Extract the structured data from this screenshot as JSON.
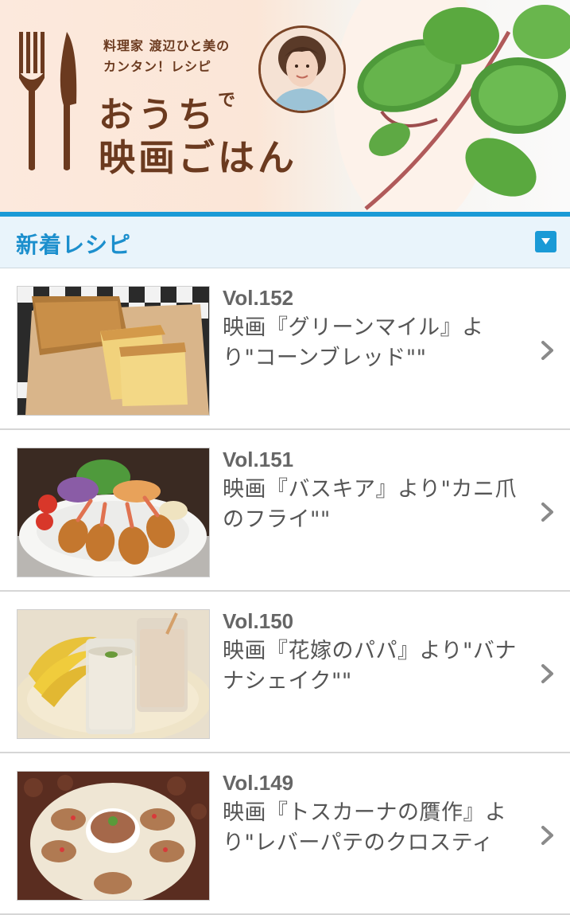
{
  "banner": {
    "subtitle_line1": "料理家 渡辺ひと美の",
    "subtitle_line2": "カンタン！レシピ",
    "title_line1_main": "おうち",
    "title_line1_small": "で",
    "title_line2": "映画ごはん"
  },
  "section": {
    "title": "新着レシピ",
    "toggle_icon": "caret-down-icon"
  },
  "recipes": [
    {
      "vol": "Vol.152",
      "title": "映画『グリーンマイル』より\"コーンブレッド\"\""
    },
    {
      "vol": "Vol.151",
      "title": "映画『バスキア』より\"カニ爪のフライ\"\""
    },
    {
      "vol": "Vol.150",
      "title": "映画『花嫁のパパ』より\"バナナシェイク\"\""
    },
    {
      "vol": "Vol.149",
      "title": "映画『トスカーナの贋作』より\"レバーパテのクロスティ"
    }
  ],
  "colors": {
    "accent": "#1a9ad6",
    "brand_brown": "#6b3a1f",
    "header_bg": "#e9f4fb"
  }
}
